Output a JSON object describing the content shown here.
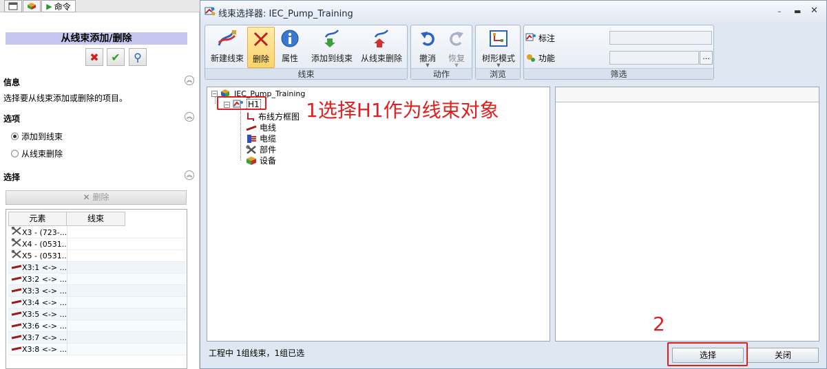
{
  "left_panel": {
    "tab_command": "命令",
    "title": "从线束添加/删除",
    "info_header": "信息",
    "info_text": "选择要从线束添加或删除的项目。",
    "options_header": "选项",
    "option_add": "添加到线束",
    "option_remove": "从线束删除",
    "option_selected": "添加到线束",
    "select_header": "选择",
    "delete_button": "删除",
    "columns": [
      "元素",
      "线束"
    ],
    "rows": [
      {
        "element": "X3 - (723-...",
        "harness": "",
        "icon": "component-icon"
      },
      {
        "element": "X4 - (0531...",
        "harness": "",
        "icon": "component-icon"
      },
      {
        "element": "X5 - (0531...",
        "harness": "",
        "icon": "component-icon"
      },
      {
        "element": "X3:1 <-> ...",
        "harness": "",
        "icon": "wire-icon"
      },
      {
        "element": "X3:2 <-> ...",
        "harness": "",
        "icon": "wire-icon"
      },
      {
        "element": "X3:3 <-> ...",
        "harness": "",
        "icon": "wire-icon"
      },
      {
        "element": "X3:4 <-> ...",
        "harness": "",
        "icon": "wire-icon"
      },
      {
        "element": "X3:5 <-> ...",
        "harness": "",
        "icon": "wire-icon"
      },
      {
        "element": "X3:6 <-> ...",
        "harness": "",
        "icon": "wire-icon"
      },
      {
        "element": "X3:7 <-> ...",
        "harness": "",
        "icon": "wire-icon"
      },
      {
        "element": "X3:8 <-> ...",
        "harness": "",
        "icon": "wire-icon"
      }
    ]
  },
  "dialog": {
    "title": "线束选择器: IEC_Pump_Training",
    "ribbon": {
      "harness_group": "线束",
      "new_harness": "新建线束",
      "delete": "删除",
      "properties": "属性",
      "add_to_harness": "添加到线束",
      "remove_from_harness": "从线束删除",
      "action_group": "动作",
      "undo": "撤消",
      "redo": "恢复",
      "browse_group": "浏览",
      "tree_mode": "树形模式",
      "filter_group": "筛选",
      "filter_mark": "标注",
      "filter_function": "功能",
      "browse_button": "..."
    },
    "tree": {
      "root": "IEC_Pump_Training",
      "harness": "H1",
      "children": [
        "布线方框图",
        "电线",
        "电缆",
        "部件",
        "设备"
      ]
    },
    "status": "工程中 1组线束，1组已选",
    "select_button": "选择",
    "close_button": "关闭"
  },
  "annotations": {
    "step1": "1选择H1作为线束对象",
    "step2": "2"
  },
  "colors": {
    "annotation_red": "#e02020",
    "panel_title_bg": "#c6c6f0",
    "ribbon_highlight": "#fbd36a"
  }
}
